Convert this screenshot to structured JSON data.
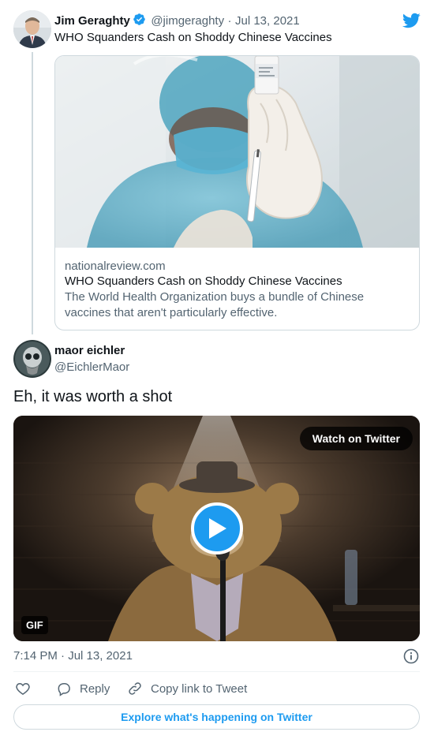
{
  "parent_tweet": {
    "author_name": "Jim Geraghty",
    "handle": "@jimgeraghty",
    "separator": "·",
    "date": "Jul 13, 2021",
    "text": "WHO Squanders Cash on Shoddy Chinese Vaccines",
    "verified": true,
    "card": {
      "domain": "nationalreview.com",
      "title": "WHO Squanders Cash on Shoddy Chinese Vaccines",
      "description": "The World Health Organization buys a bundle of Chinese vaccines that aren't particularly effective."
    }
  },
  "reply_tweet": {
    "author_name": "maor eichler",
    "handle": "@EichlerMaor",
    "text": "Eh, it was worth a shot",
    "media": {
      "watch_label": "Watch on Twitter",
      "gif_label": "GIF"
    },
    "timestamp": "7:14 PM · Jul 13, 2021"
  },
  "actions": {
    "reply_label": "Reply",
    "copy_label": "Copy link to Tweet"
  },
  "explore_label": "Explore what's happening on Twitter",
  "colors": {
    "accent": "#1d9bf0",
    "text": "#0f1419",
    "muted": "#536471",
    "border": "#cfd9de"
  },
  "icons": [
    "twitter-bird-icon",
    "verified-badge-icon",
    "play-icon",
    "info-icon",
    "heart-icon",
    "reply-icon",
    "copy-link-icon"
  ]
}
